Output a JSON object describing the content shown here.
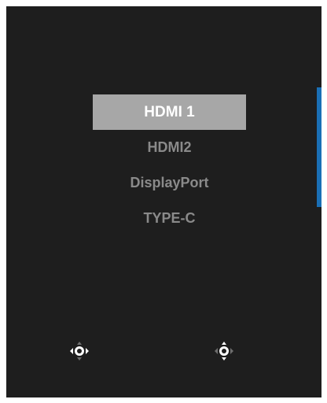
{
  "osd": {
    "inputs": [
      {
        "label": "HDMI 1",
        "selected": true
      },
      {
        "label": "HDMI2",
        "selected": false
      },
      {
        "label": "DisplayPort",
        "selected": false
      },
      {
        "label": "TYPE-C",
        "selected": false
      }
    ]
  },
  "controls": {
    "left": {
      "icon": "joystick-left-right-icon"
    },
    "right": {
      "icon": "joystick-up-down-icon"
    }
  },
  "colors": {
    "screen_bg": "#1e1e1e",
    "selected_bg": "#a7a7a7",
    "selected_text": "#ffffff",
    "item_text": "#8a8a8a",
    "accent": "#1a6fb5"
  }
}
